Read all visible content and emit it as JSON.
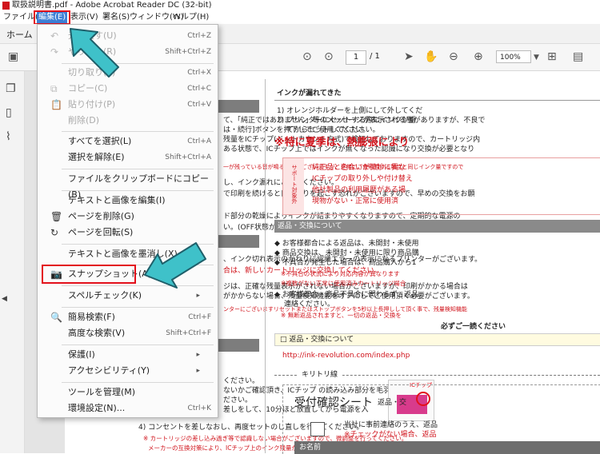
{
  "window": {
    "title": "取扱説明書.pdf - Adobe Acrobat Reader DC (32-bit)"
  },
  "menubar": {
    "items": [
      "ファイル(F)",
      "編集(E)",
      "表示(V)",
      "署名(S)",
      "ウィンドウ(W)",
      "ヘルプ(H)"
    ]
  },
  "tabs": {
    "home": "ホーム"
  },
  "toolbar": {
    "page_current": "1",
    "page_total": "/ 1",
    "zoom": "100%"
  },
  "edit_menu": {
    "items": [
      {
        "label": "元に戻す(U)",
        "shortcut": "Ctrl+Z"
      },
      {
        "label": "やり直し(R)",
        "shortcut": "Shift+Ctrl+Z"
      },
      {
        "label": "切り取り(T)",
        "shortcut": "Ctrl+X"
      },
      {
        "label": "コピー(C)",
        "shortcut": "Ctrl+C"
      },
      {
        "label": "貼り付け(P)",
        "shortcut": "Ctrl+V"
      },
      {
        "label": "削除(D)",
        "shortcut": ""
      },
      {
        "label": "すべてを選択(L)",
        "shortcut": "Ctrl+A"
      },
      {
        "label": "選択を解除(E)",
        "shortcut": "Shift+Ctrl+A"
      },
      {
        "label": "ファイルをクリップボードにコピー(B)",
        "shortcut": ""
      },
      {
        "label": "テキストと画像を編集(I)",
        "shortcut": ""
      },
      {
        "label": "ページを削除(G)",
        "shortcut": ""
      },
      {
        "label": "ページを回転(S)",
        "shortcut": ""
      },
      {
        "label": "テキストと画像を墨消し(X)",
        "shortcut": ""
      },
      {
        "label": "スナップショット(A)",
        "shortcut": ""
      },
      {
        "label": "スペルチェック(K)",
        "shortcut": ""
      },
      {
        "label": "簡易検索(F)",
        "shortcut": "Ctrl+F"
      },
      {
        "label": "高度な検索(V)",
        "shortcut": "Shift+Ctrl+F"
      },
      {
        "label": "保護(I)",
        "shortcut": ""
      },
      {
        "label": "アクセシビリティ(Y)",
        "shortcut": ""
      },
      {
        "label": "ツールを管理(M)",
        "shortcut": ""
      },
      {
        "label": "環境設定(N)...",
        "shortcut": "Ctrl+K"
      }
    ]
  },
  "document": {
    "lines": [
      "て、「純正ではありません」等のメッセージが表示される事がありますが、不良で",
      "は・続行]ボタンを押下してご使用ください。",
      "残量をICチップ(ドットカウント方式)で検知しておりますので、カートリッジ内",
      "ある状態で、ICチップ上ではインクが無くなった認識になり交換が必要となり",
      "一が残っている音が鳴る場合がございますが、正常にご使用頂ける場合と同じインク量ですので",
      "し、インク漏れにご注意ください。",
      "で印刷を続けると目詰まりを起こす恐れがございますので、早めの交換をお願",
      "ド部分の乾燥によりインクが詰まりやすくなりますので、定期的な電源の",
      "い。(OFF状態が 長期間続きますとトラブルの原因になります)",
      "、インク切れ表示のかわりに認識エラーの表示になるプリンターがございます。",
      "合は、新しいカートリッジに交換してください。",
      "ジは、正確な残量表示がされない場合がございますが、印刷がかかる場合は",
      "がかからない場合、残量検知機能をオフにしてご使用頂く必要がございます。",
      "ンターにございますリセットまたはストップボタンを5秒以上長押しして頂く事で、残量検知機能",
      "ください。",
      "ないかご確認頂き、ICチップ の読み込み部分を毛羽",
      "ださい。",
      "差しをして、10分ほど放置してから電源を入",
      "4) コンセントを差しなおし、再度セットのし直しを行ってください。",
      "※ カートリッジの差し込み過ぎ等で認識しない場合がございますので、微調整を行ってください。",
      "メーカーの互換対策により、ICチップ上のインク残量がなくなると、認識エラーの表示がされる場合がございます。"
    ],
    "chip_label": "ICチップ",
    "right": {
      "ink_leak_title": "インクが漏れてきた",
      "ink_leak_1": "1) オレンジホルダーを上側にして外してくだ",
      "ink_leak_2": "2) プリンターにセットする際にインクが垂",
      "ink_leak_3": "てからセットしてください。",
      "summer_warning": "※特に夏季は、熱膨張により",
      "support_vertical": "サポート対象外",
      "notes": [
        "純正品と色合いが微妙に異な",
        "ICチップの取り外しや付け替え",
        "他社製品の利用履歴がある場",
        "現物がない・正常に使用済"
      ],
      "return_title": "返品・交換について",
      "return_lines": [
        "◆ お客様都合による返品は、未開封・未使用",
        "◆ 商品交換は、未開封・未使用に限り商品購",
        "◆ 不具合が発生した場合は、商品購入から1",
        "※不具合の状況により対応内容が異なります",
        "※複数がない正常に使用済みカートリッジ場合",
        "◆ お客様都合・商品不具合に関わらず、返品",
        "連絡ください。",
        "※ 無断返品されますと、一切の返品・交換を",
        "必ずご一読ください"
      ],
      "return_box": "□ 返品・交換について",
      "url": "http://ink-revolution.com/index.php",
      "cutline": "キリトリ線",
      "receipt_title": "受付確認シート",
      "receipt_sub": "返品・交",
      "receipt_note": "当社に事前連絡のうえ、返品",
      "receipt_note2": "※チェックがない場合、返品",
      "name_label": "お名前"
    }
  },
  "colors": {
    "accent": "#3d7fd6",
    "highlight_red": "#e3101b",
    "callout_teal": "#3fc1c9"
  }
}
